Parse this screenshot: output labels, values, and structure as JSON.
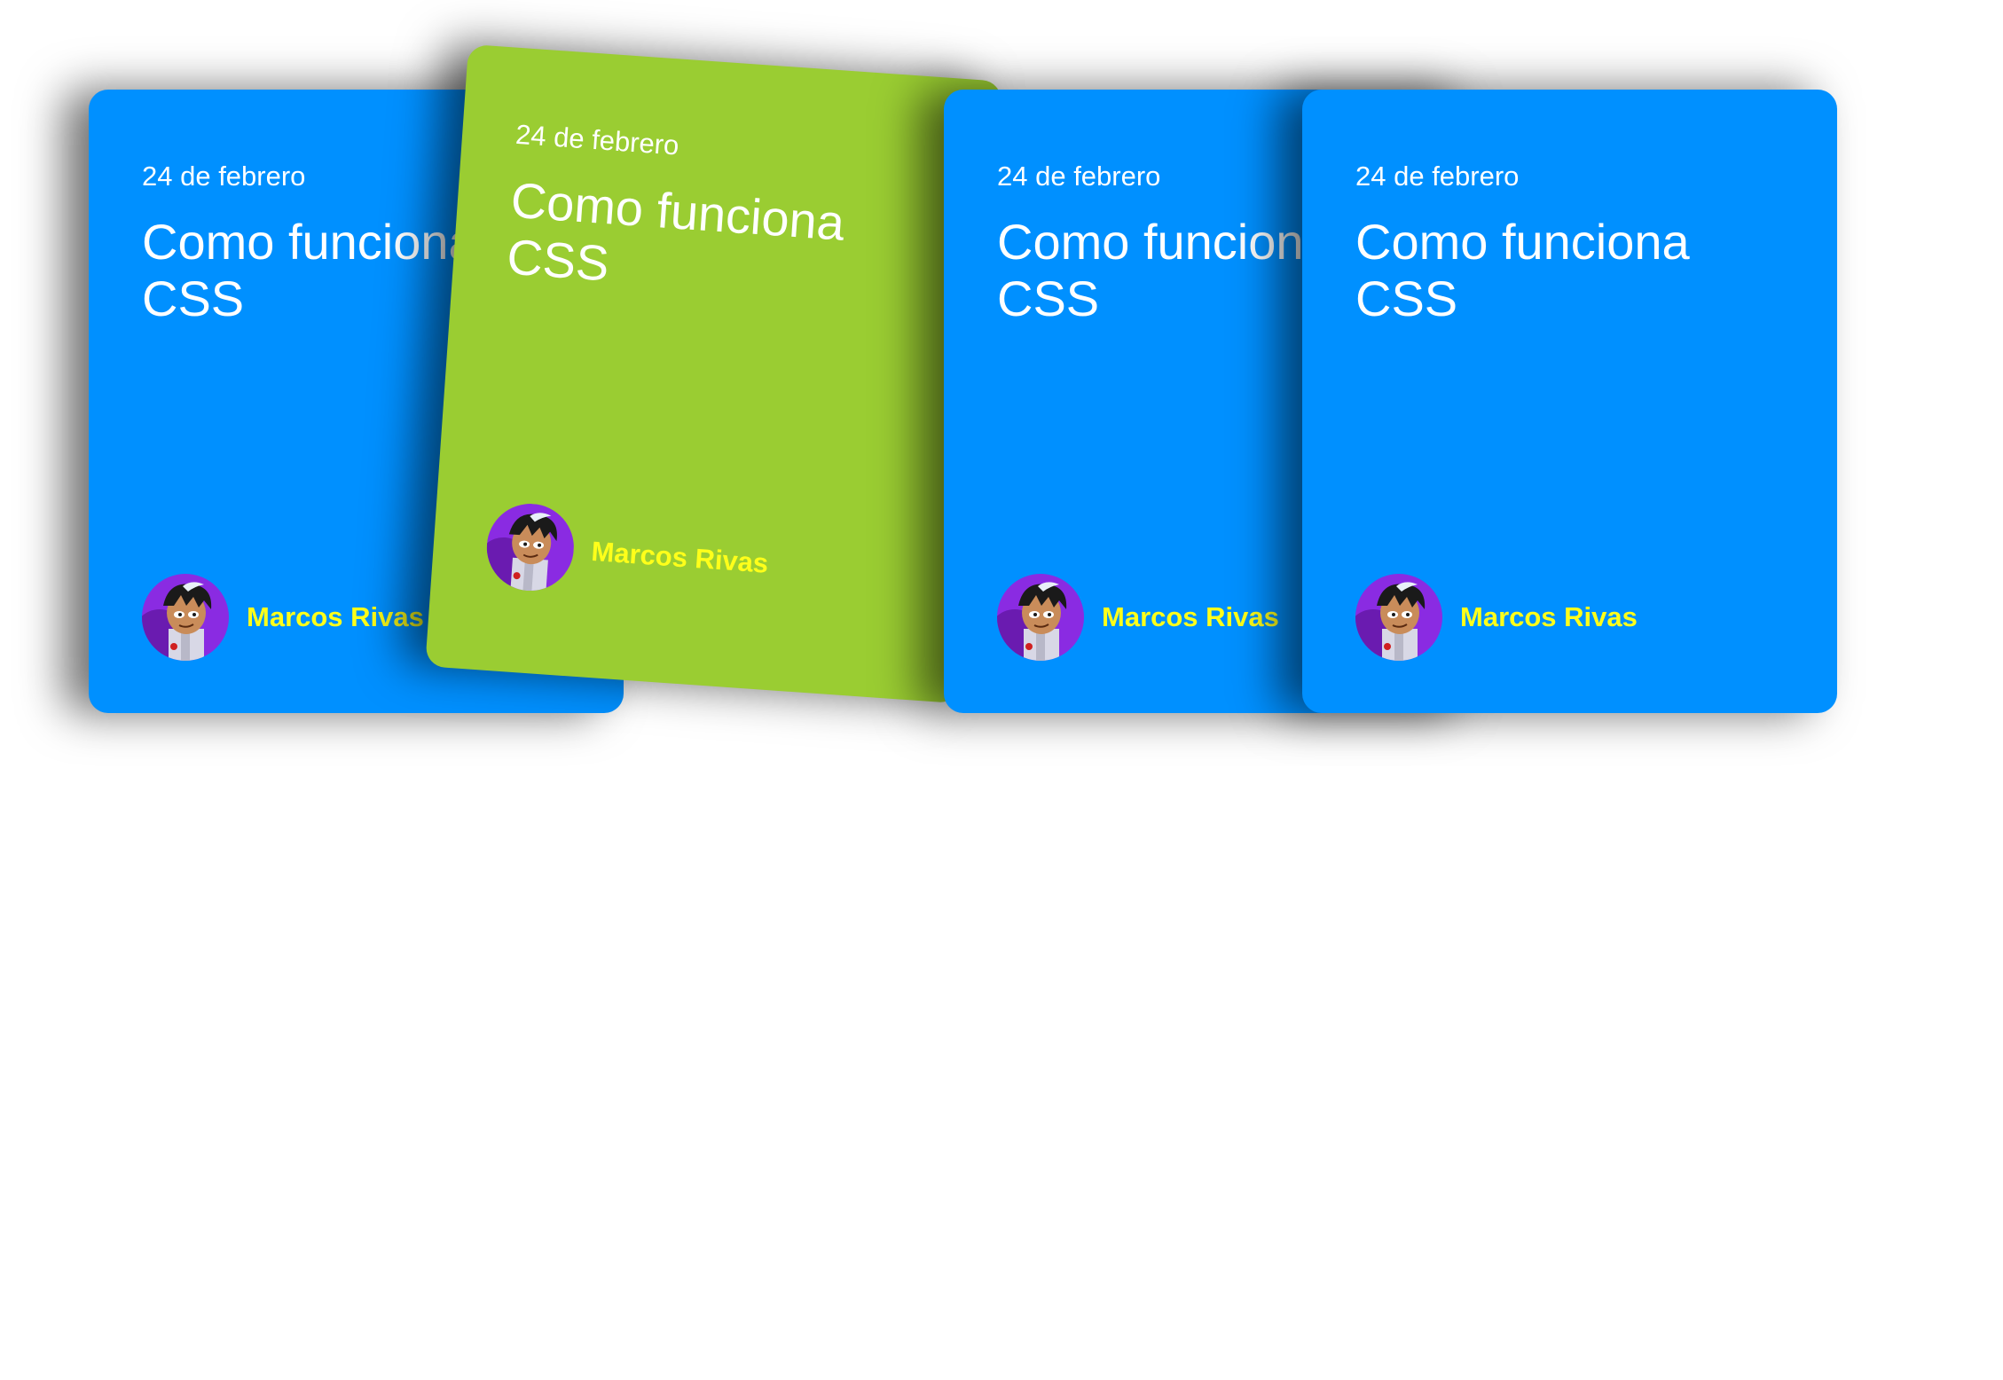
{
  "cards": [
    {
      "date": "24 de febrero",
      "title": "Como funciona CSS",
      "author": "Marcos Rivas",
      "color": "#0090ff"
    },
    {
      "date": "24 de febrero",
      "title": "Como funciona CSS",
      "author": "Marcos Rivas",
      "color": "#9acd32"
    },
    {
      "date": "24 de febrero",
      "title": "Como funciona CSS",
      "author": "Marcos Rivas",
      "color": "#0090ff"
    },
    {
      "date": "24 de febrero",
      "title": "Como funciona CSS",
      "author": "Marcos Rivas",
      "color": "#0090ff"
    }
  ],
  "author_color": "#ffff1a",
  "avatar_icon": "cartoon-avatar"
}
